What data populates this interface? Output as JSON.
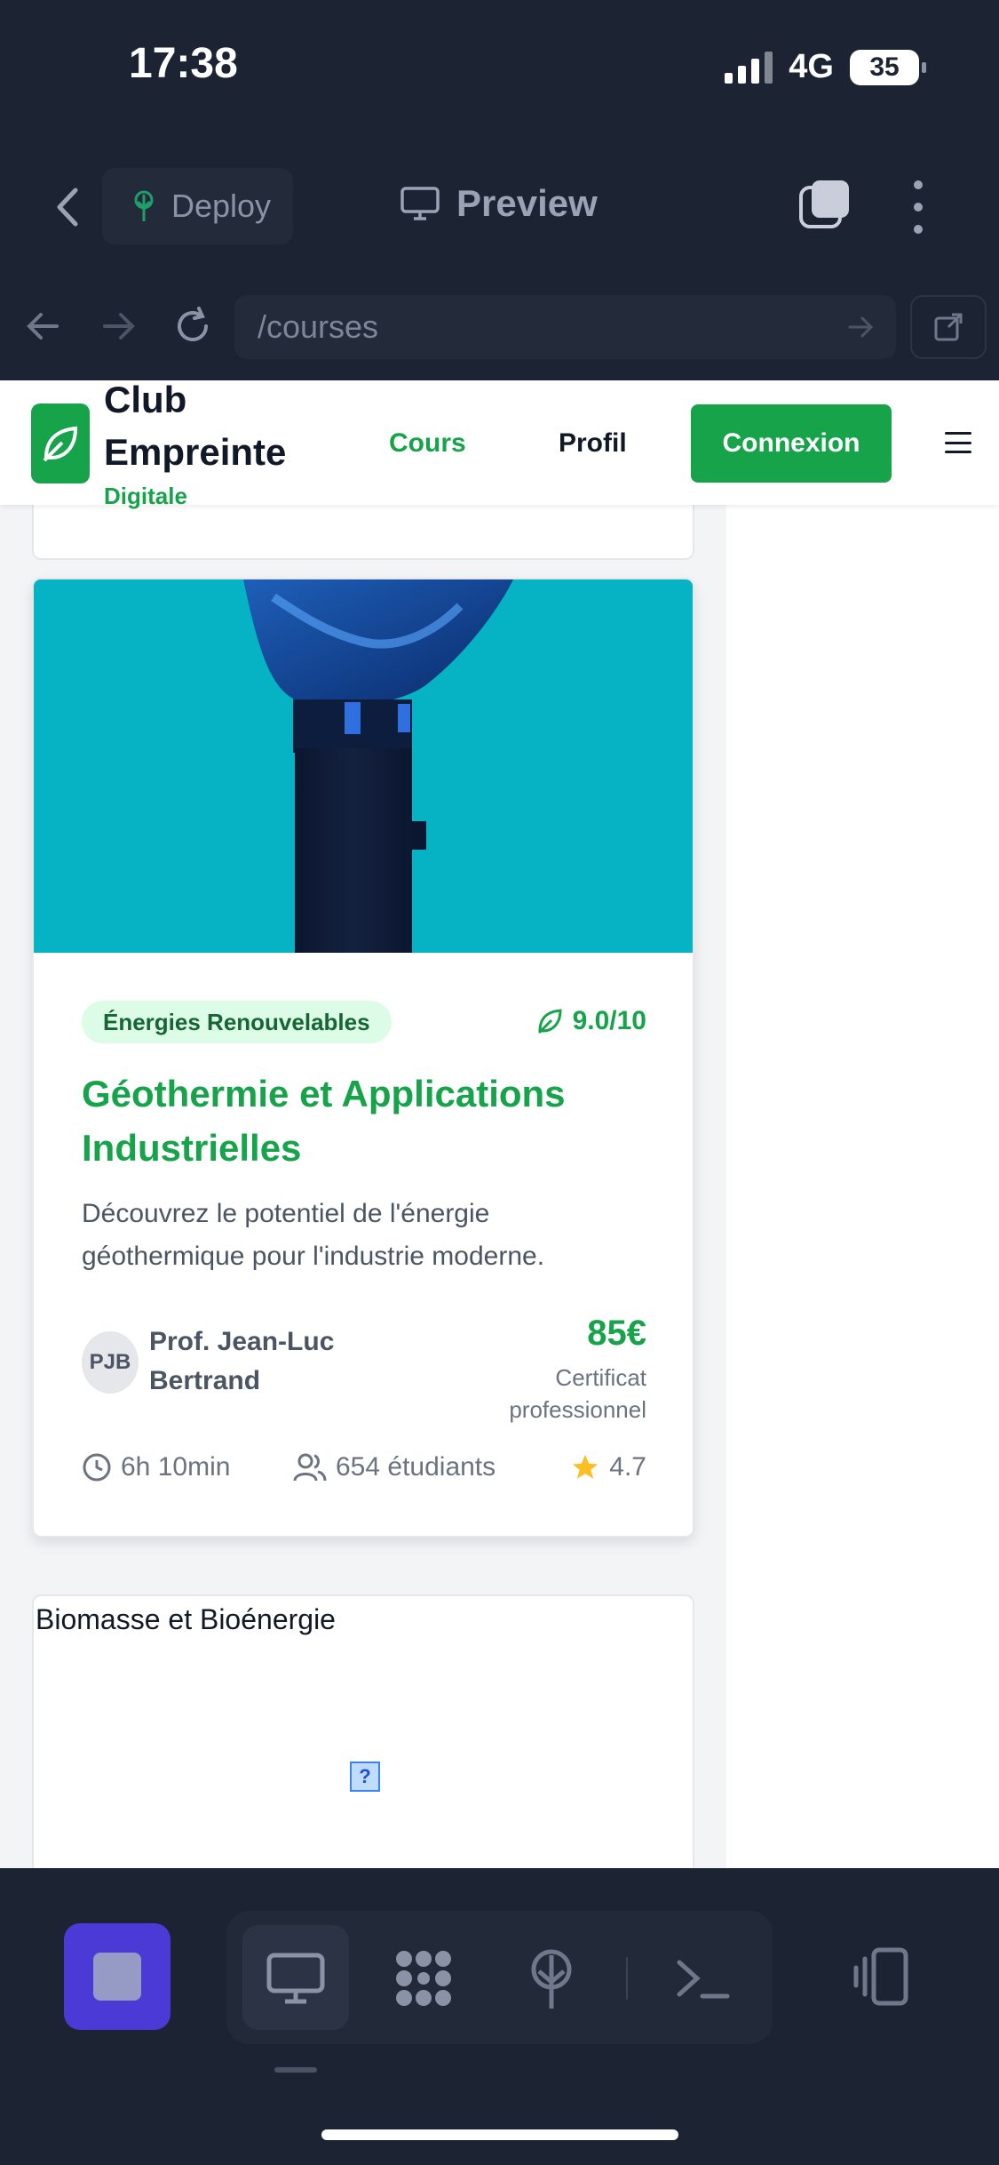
{
  "status": {
    "time": "17:38",
    "network": "4G",
    "battery": "35"
  },
  "toolbar": {
    "deploy_label": "Deploy",
    "preview_label": "Preview"
  },
  "urlbar": {
    "path": "/courses"
  },
  "site": {
    "brand_line1": "Club",
    "brand_line2": "Empreinte",
    "brand_sub": "Digitale",
    "nav": {
      "courses": "Cours",
      "profile": "Profil",
      "login": "Connexion"
    }
  },
  "course": {
    "category": "Énergies Renouvelables",
    "score": "9.0/10",
    "title": "Géothermie et Applications Industrielles",
    "description": "Découvrez le potentiel de l'énergie géothermique pour l'industrie moderne.",
    "instructor_initials": "PJB",
    "instructor_name": "Prof. Jean-Luc Bertrand",
    "price": "85€",
    "certificate": "Certificat professionnel",
    "duration": "6h 10min",
    "students": "654 étudiants",
    "rating": "4.7"
  },
  "next_course": {
    "title": "Biomasse et Bioénergie",
    "image_placeholder": "?"
  },
  "colors": {
    "accent": "#16a34a",
    "app_bg": "#1c2333",
    "stop_button": "#4c3ad6"
  }
}
